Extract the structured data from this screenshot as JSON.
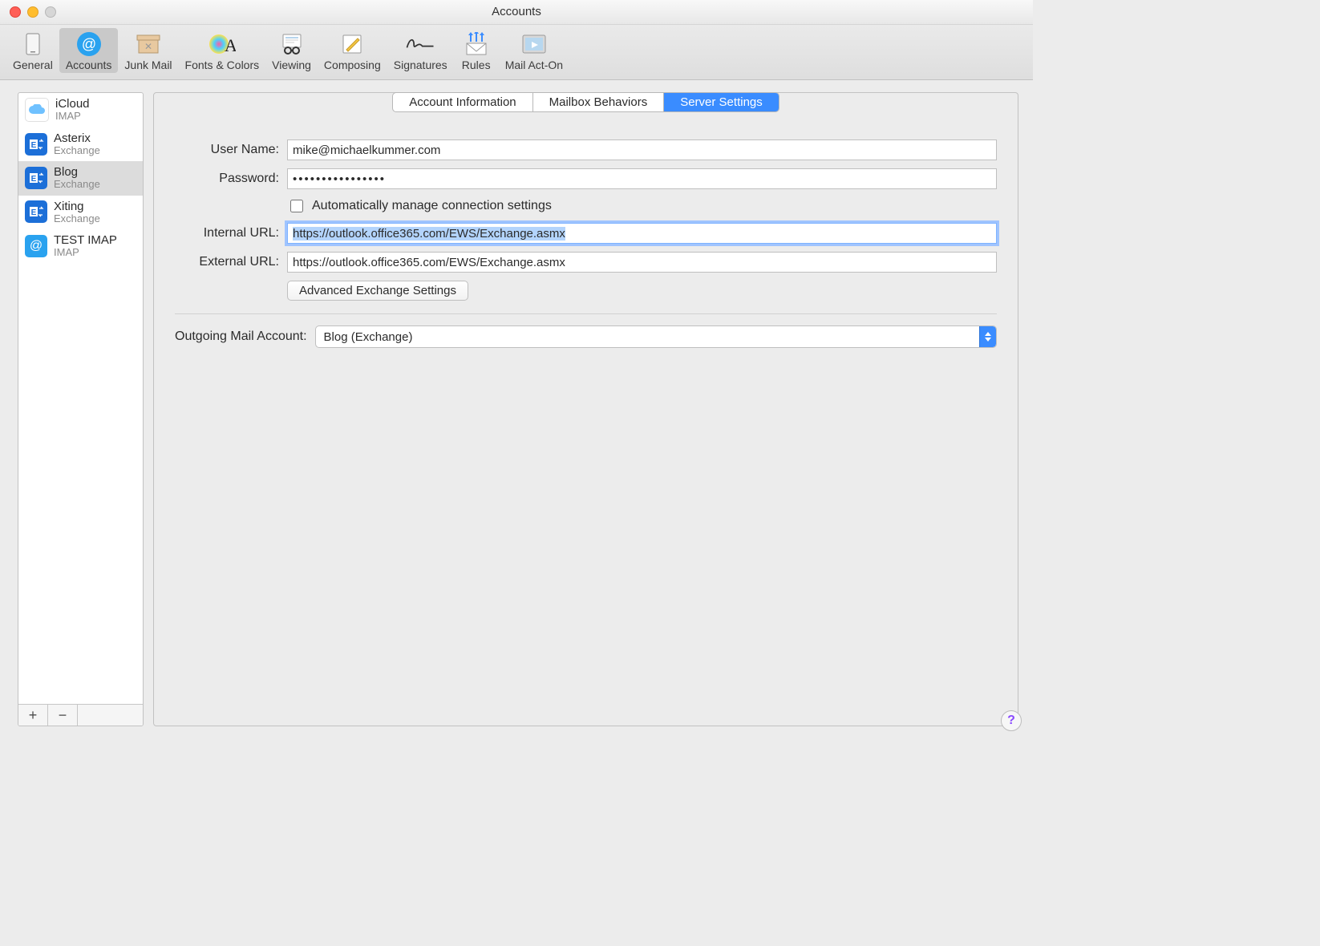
{
  "window": {
    "title": "Accounts"
  },
  "toolbar": {
    "items": [
      {
        "id": "general",
        "label": "General"
      },
      {
        "id": "accounts",
        "label": "Accounts"
      },
      {
        "id": "junk-mail",
        "label": "Junk Mail"
      },
      {
        "id": "fonts-colors",
        "label": "Fonts & Colors"
      },
      {
        "id": "viewing",
        "label": "Viewing"
      },
      {
        "id": "composing",
        "label": "Composing"
      },
      {
        "id": "signatures",
        "label": "Signatures"
      },
      {
        "id": "rules",
        "label": "Rules"
      },
      {
        "id": "mail-act-on",
        "label": "Mail Act-On"
      }
    ],
    "active": "accounts"
  },
  "sidebar": {
    "accounts": [
      {
        "name": "iCloud",
        "type": "IMAP",
        "icon": "icloud"
      },
      {
        "name": "Asterix",
        "type": "Exchange",
        "icon": "exchange"
      },
      {
        "name": "Blog",
        "type": "Exchange",
        "icon": "exchange"
      },
      {
        "name": "Xiting",
        "type": "Exchange",
        "icon": "exchange"
      },
      {
        "name": "TEST IMAP",
        "type": "IMAP",
        "icon": "imap"
      }
    ],
    "selected_index": 2,
    "footer": {
      "add": "+",
      "remove": "−"
    }
  },
  "tabs": {
    "items": [
      "Account Information",
      "Mailbox Behaviors",
      "Server Settings"
    ],
    "active_index": 2
  },
  "form": {
    "username_label": "User Name:",
    "username_value": "mike@michaelkummer.com",
    "password_label": "Password:",
    "password_value": "••••••••••••••••",
    "auto_manage_label": "Automatically manage connection settings",
    "auto_manage_checked": false,
    "internal_url_label": "Internal URL:",
    "internal_url_value": "https://outlook.office365.com/EWS/Exchange.asmx",
    "external_url_label": "External URL:",
    "external_url_value": "https://outlook.office365.com/EWS/Exchange.asmx",
    "advanced_button": "Advanced Exchange Settings",
    "outgoing_label": "Outgoing Mail Account:",
    "outgoing_value": "Blog (Exchange)"
  },
  "help": {
    "glyph": "?"
  }
}
